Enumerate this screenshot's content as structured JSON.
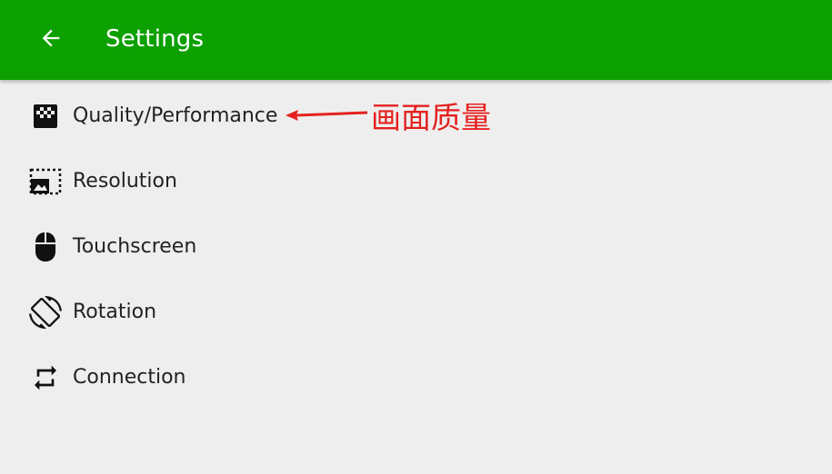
{
  "toolbar": {
    "title": "Settings",
    "back_icon": "arrow-back-icon",
    "background_color": "#0ca000"
  },
  "menu": {
    "items": [
      {
        "label": "Quality/Performance",
        "icon": "quality-icon"
      },
      {
        "label": "Resolution",
        "icon": "resolution-icon"
      },
      {
        "label": "Touchscreen",
        "icon": "mouse-icon"
      },
      {
        "label": "Rotation",
        "icon": "rotation-icon"
      },
      {
        "label": "Connection",
        "icon": "sync-icon"
      }
    ]
  },
  "annotation": {
    "text": "画面质量",
    "color": "#e5211f"
  }
}
